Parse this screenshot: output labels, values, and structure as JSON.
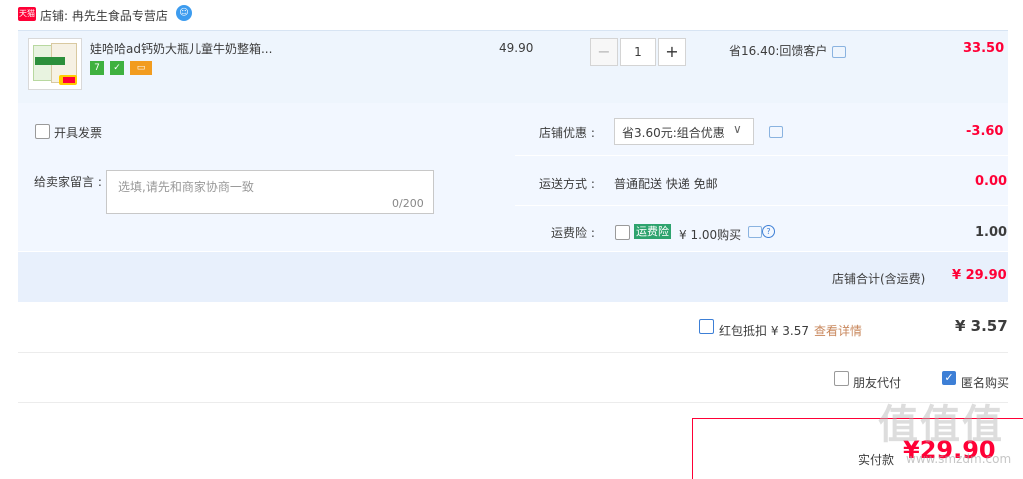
{
  "shop": {
    "badge": "天猫",
    "label": "店铺: 冉先生食品专营店",
    "ww_icon": "wangwang-chat-icon"
  },
  "item": {
    "title": "娃哈哈ad钙奶大瓶儿童牛奶整箱...",
    "service_icons": [
      "7-day-return-icon",
      "guarantee-icon",
      "credit-card-icon"
    ],
    "service_text": [
      "7",
      "✓",
      "▭"
    ],
    "unit_price": "49.90",
    "quantity": "1",
    "qty_minus": "−",
    "qty_plus": "+",
    "discount_text": "省16.40:回馈客户",
    "subtotal": "33.50"
  },
  "invoice": {
    "label": "开具发票"
  },
  "message": {
    "label": "给卖家留言 :",
    "placeholder": "选填,请先和商家协商一致",
    "counter": "0/200"
  },
  "shop_discount": {
    "label": "店铺优惠 :",
    "selected": "省3.60元:组合优惠",
    "amount": "-3.60"
  },
  "shipping": {
    "label": "运送方式 :",
    "method": "普通配送 快递 免邮",
    "amount": "0.00"
  },
  "insurance": {
    "label": "运费险 :",
    "tag": "运费险",
    "price_text": "¥ 1.00购买",
    "amount": "1.00"
  },
  "shop_total": {
    "label": "店铺合计(含运费)",
    "amount": "¥ 29.90"
  },
  "red_packet": {
    "label": "红包抵扣 ¥ 3.57",
    "link": "查看详情",
    "amount": "¥ 3.57"
  },
  "options": {
    "friend_pay": "朋友代付",
    "anonymous": "匿名购买"
  },
  "payment": {
    "label": "实付款",
    "amount": "¥29.90"
  },
  "watermark": {
    "main": "值值值",
    "sub": "www.smzdm.com"
  },
  "colors": {
    "accent_red": "#ff0036",
    "link_blue": "#3d7fd6",
    "row_bg": "#eef5fd"
  }
}
